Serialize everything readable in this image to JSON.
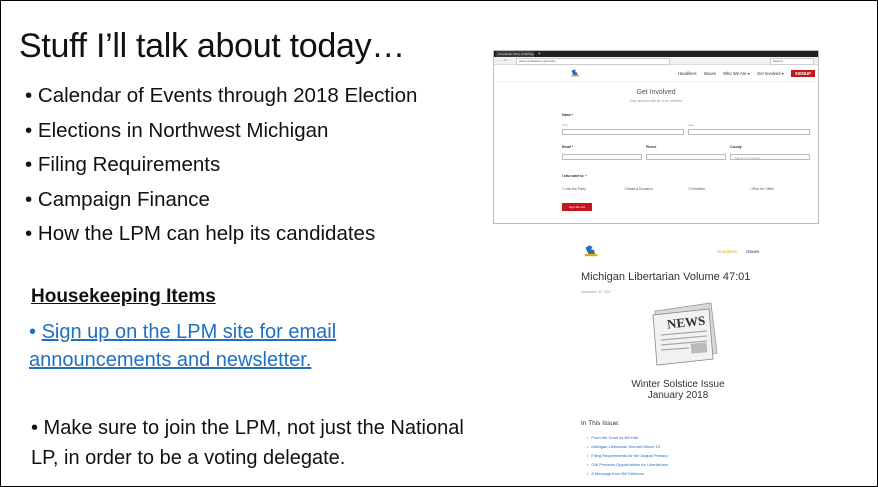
{
  "slide": {
    "title": "Stuff I’ll talk about today…",
    "bullet_char": "•",
    "bullets": [
      "Calendar of Events through 2018 Election",
      "Elections in Northwest Michigan",
      "Filing Requirements",
      "Campaign Finance",
      "How the LPM can help its candidates"
    ],
    "housekeeping_title": "Housekeeping Items",
    "signup_link": "Sign up on the LPM site for email announcements and newsletter.",
    "join_note": "• Make sure to join the LPM, not just the National LP, in order to be a voting delegate."
  },
  "browser": {
    "tab_title": "Libertarian Party of Michigan",
    "tab_new": "+",
    "nav_glyphs": "← → C ⌂",
    "url": "www.michiganlp.org/involve",
    "search_placeholder": "Search"
  },
  "site_nav": {
    "items": [
      "Headlines",
      "Issues",
      "Who We Are ▾",
      "Get Involved ▾"
    ],
    "signup": "SIGNUP"
  },
  "get_involved": {
    "title": "Get Involved",
    "subtitle": "Stay informed with all of our activities",
    "name_label": "Name *",
    "first_label": "First",
    "last_label": "Last",
    "email_label": "Email *",
    "phone_label": "Phone",
    "county_label": "County",
    "county_placeholder": "- Select Your County -",
    "want_label": "I also want to: *",
    "options": [
      "Join the Party",
      "Make a Donation",
      "Volunteer",
      "Run for Office"
    ],
    "submit": "Sign Me Up!"
  },
  "newsletter": {
    "nav_headlines": "Headlines",
    "nav_issues": "Issues",
    "title": "Michigan Libertarian Volume 47:01",
    "date": "December 30, 2017",
    "news_word": "NEWS",
    "issue_line1": "Winter Solstice Issue",
    "issue_line2": "January 2018",
    "in_this_issue": "In This Issue:",
    "items": [
      "From the Chair by Bill Hall",
      "Michigan Libertarian Summit March 10",
      "Filing Requirements for the August Primary",
      "GAI Presents Opportunities for Libertarians",
      "A Message from Bill Gelineau"
    ]
  }
}
